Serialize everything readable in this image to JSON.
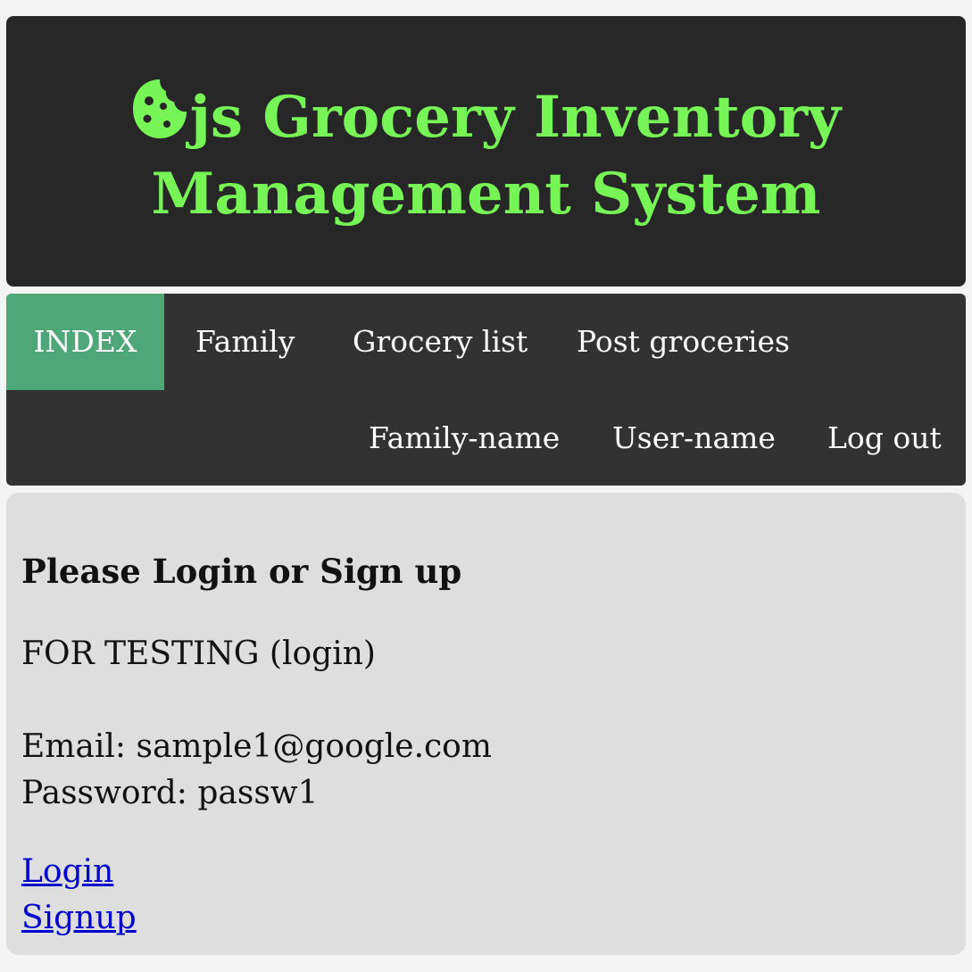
{
  "header": {
    "title_line1": "js Grocery Inventory",
    "title_line2": "Management System",
    "logo_icon": "cookie-icon",
    "title_color": "#77f556"
  },
  "nav": {
    "primary": [
      {
        "label": "INDEX",
        "active": true
      },
      {
        "label": "Family",
        "active": false
      },
      {
        "label": "Grocery list",
        "active": false
      },
      {
        "label": "Post groceries",
        "active": false
      }
    ],
    "secondary": [
      {
        "label": "Family-name"
      },
      {
        "label": "User-name"
      },
      {
        "label": "Log out"
      }
    ],
    "active_color": "#4fa777"
  },
  "main": {
    "heading": "Please Login or Sign up",
    "testing_note": "FOR TESTING (login)",
    "email_line": "Email: sample1@google.com",
    "password_line": "Password: passw1",
    "login_link": "Login",
    "signup_link": "Signup"
  }
}
